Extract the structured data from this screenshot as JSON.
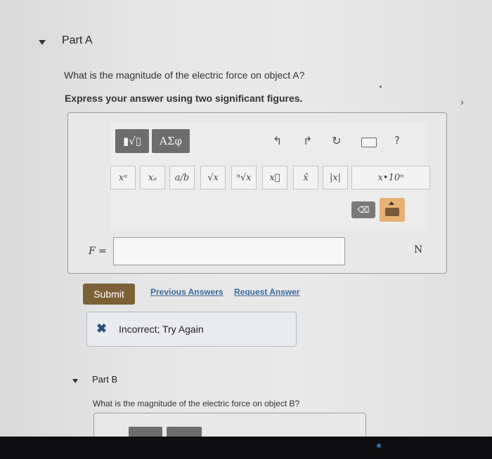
{
  "partA": {
    "title": "Part A",
    "question": "What is the magnitude of the electric force on object A?",
    "instruction": "Express your answer using two significant figures."
  },
  "toolbar": {
    "templates_label": "▮√▯",
    "greek_label": "ΑΣφ",
    "undo_icon": "undo-icon",
    "redo_icon": "redo-icon",
    "reset_icon": "reset-icon",
    "keyboard_icon": "keyboard-icon",
    "help_label": "?",
    "symbols": [
      "xᵃ",
      "xₐ",
      "a/b",
      "√x",
      "ⁿ√x",
      "x⃗",
      "x̂",
      "|x|",
      "x•10ⁿ"
    ],
    "delete_label": "⌫"
  },
  "answer": {
    "label": "F =",
    "value": "",
    "unit": "N"
  },
  "actions": {
    "submit": "Submit",
    "previous_answers": "Previous Answers",
    "request_answer": "Request Answer"
  },
  "feedback": {
    "icon": "✖",
    "message": "Incorrect; Try Again"
  },
  "partB": {
    "title": "Part B",
    "question": "What is the magnitude of the electric force on object B?"
  },
  "colors": {
    "submit_bg": "#7c6136",
    "link": "#3b6aa0",
    "feedback_icon": "#2b4e84",
    "keyboard_toggle": "#e5b273"
  }
}
